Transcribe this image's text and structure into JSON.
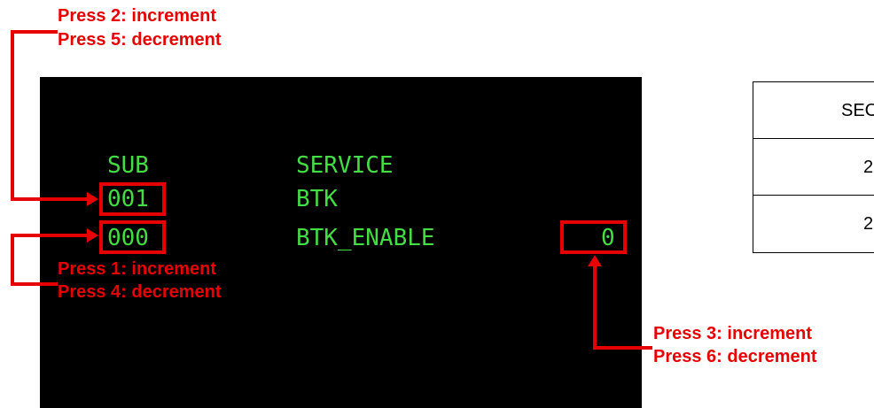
{
  "screen": {
    "header_sub": "SUB",
    "header_service": "SERVICE",
    "row1_sub": "001",
    "row1_service": "BTK",
    "row2_sub": "000",
    "row2_service": "BTK_ENABLE",
    "row2_value": "0"
  },
  "annotations": {
    "top": [
      "Press 2: increment",
      "Press 5: decrement"
    ],
    "middle": [
      "Press 1: increment",
      "Press 4: decrement"
    ],
    "bottom": [
      "Press 3: increment",
      "Press 6: decrement"
    ]
  },
  "table": {
    "header": "SEC",
    "rows": [
      "2",
      "2"
    ]
  },
  "colors": {
    "annotation": "#e60000",
    "screen_text": "#44dd44",
    "screen_background": "#000000"
  }
}
